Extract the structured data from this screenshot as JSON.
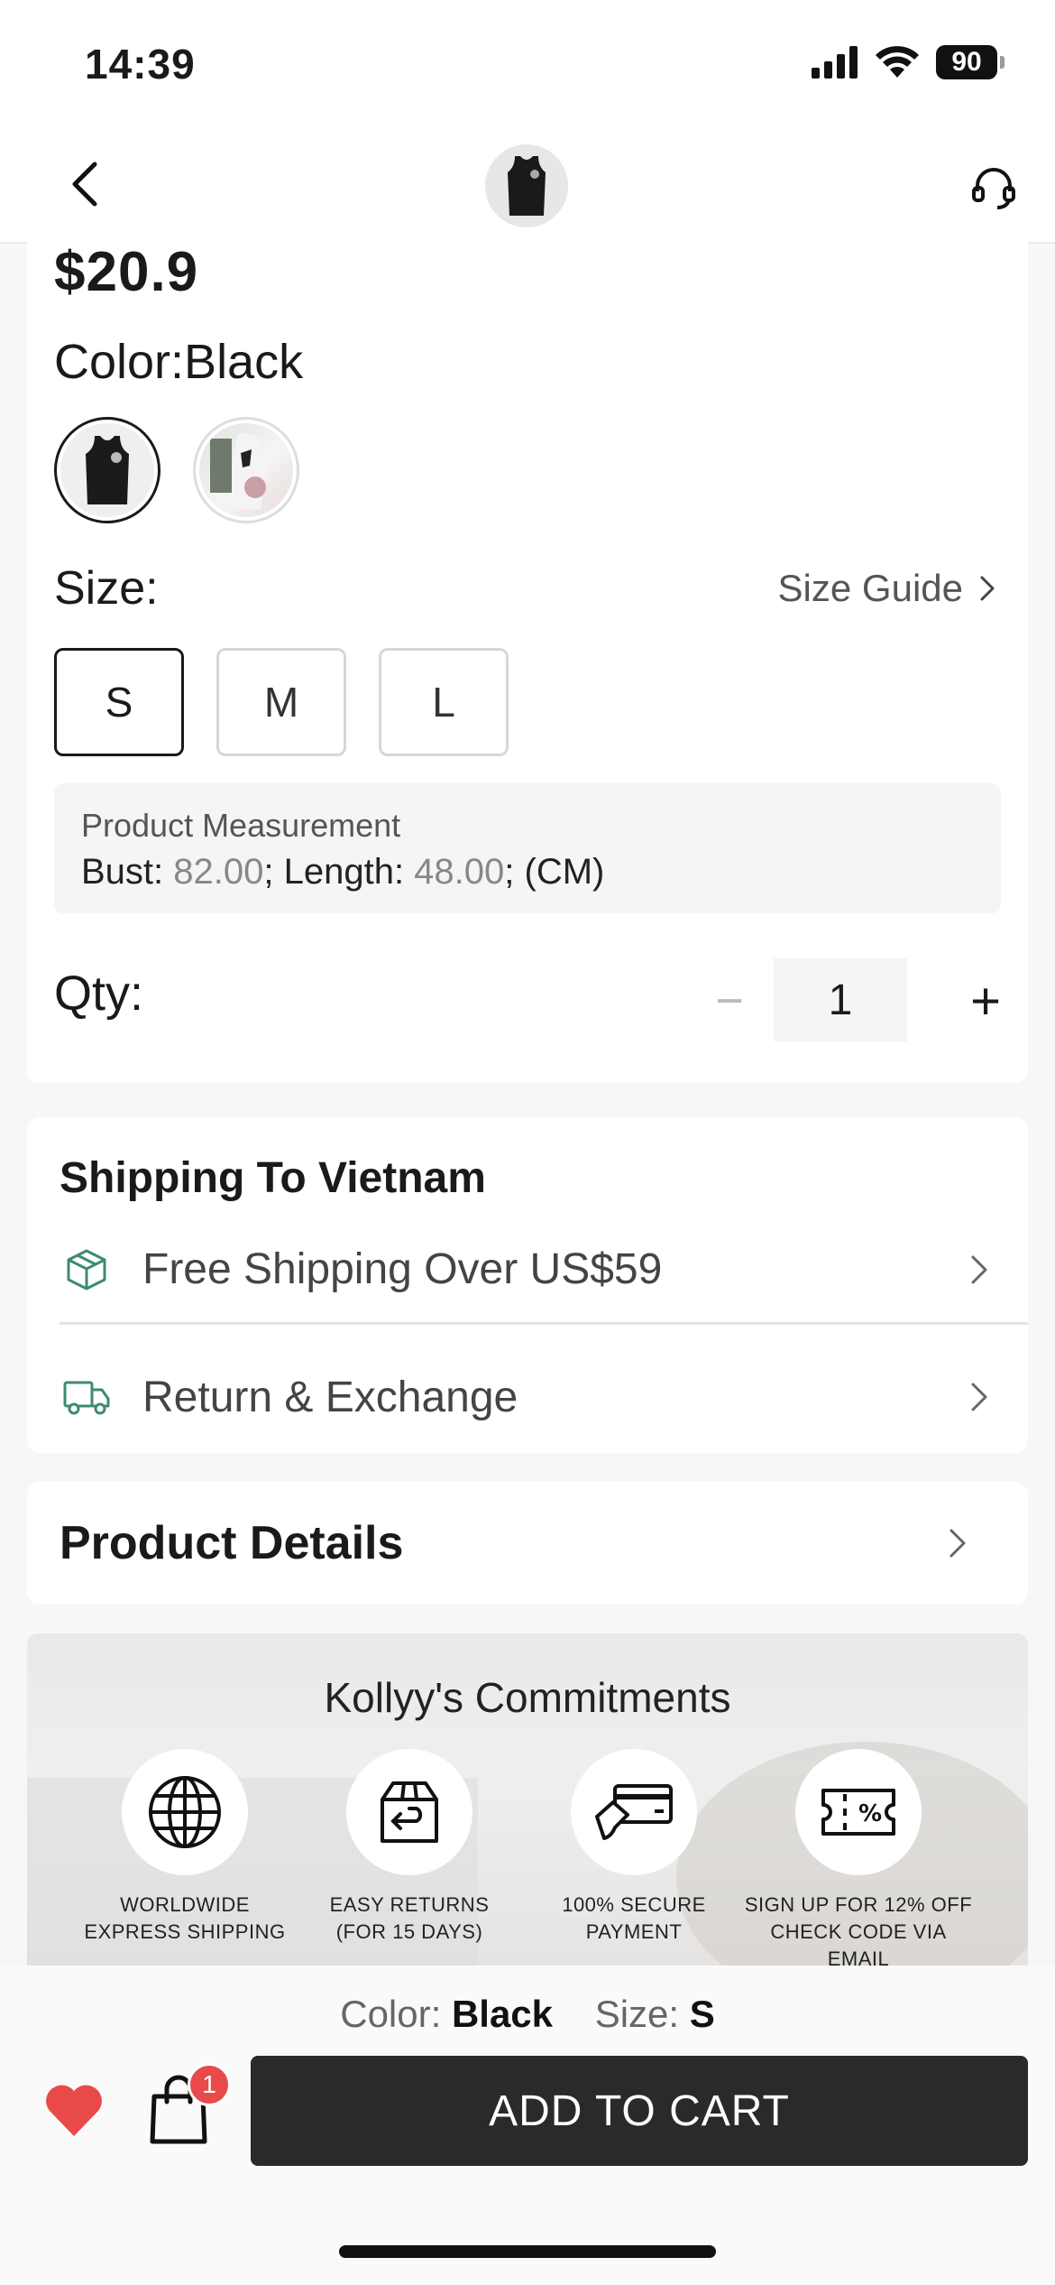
{
  "status_bar": {
    "time": "14:39",
    "battery": "90"
  },
  "nav": {
    "back_icon": "chevron-left-icon",
    "support_icon": "headset-icon"
  },
  "product": {
    "price": "$20.9",
    "color_label": "Color:",
    "color_value": "Black",
    "swatches": [
      {
        "name": "Black",
        "selected": true
      },
      {
        "name": "White",
        "selected": false
      }
    ],
    "size_label": "Size:",
    "size_guide": "Size Guide",
    "sizes": [
      "S",
      "M",
      "L"
    ],
    "selected_size": "S",
    "measurement": {
      "title": "Product Measurement",
      "bust_label": "Bust: ",
      "bust_value": "82.00",
      "length_label": "; Length: ",
      "length_value": "48.00",
      "unit": "; (CM)"
    },
    "qty_label": "Qty:",
    "qty_value": "1",
    "qty_minus": "−",
    "qty_plus": "+"
  },
  "shipping": {
    "title": "Shipping To Vietnam",
    "rows": [
      {
        "label": "Free Shipping Over US$59",
        "icon": "package-icon"
      },
      {
        "label": "Return & Exchange",
        "icon": "truck-icon"
      }
    ]
  },
  "details": {
    "title": "Product Details"
  },
  "commitments": {
    "title": "Kollyy's Commitments",
    "items": [
      {
        "label": "WORLDWIDE\nEXPRESS SHIPPING",
        "icon": "globe-icon"
      },
      {
        "label": "EASY RETURNS\n(FOR 15 DAYS)",
        "icon": "return-box-icon"
      },
      {
        "label": "100% SECURE\nPAYMENT",
        "icon": "credit-card-icon"
      },
      {
        "label": "SIGN UP FOR 12% OFF\nCHECK CODE VIA EMAIL",
        "icon": "coupon-icon"
      }
    ]
  },
  "bottom": {
    "color_label": "Color: ",
    "color_value": "Black",
    "size_label": "Size: ",
    "size_value": "S",
    "cart_count": "1",
    "add_to_cart": "ADD TO CART",
    "accent": "#e84a4a"
  }
}
